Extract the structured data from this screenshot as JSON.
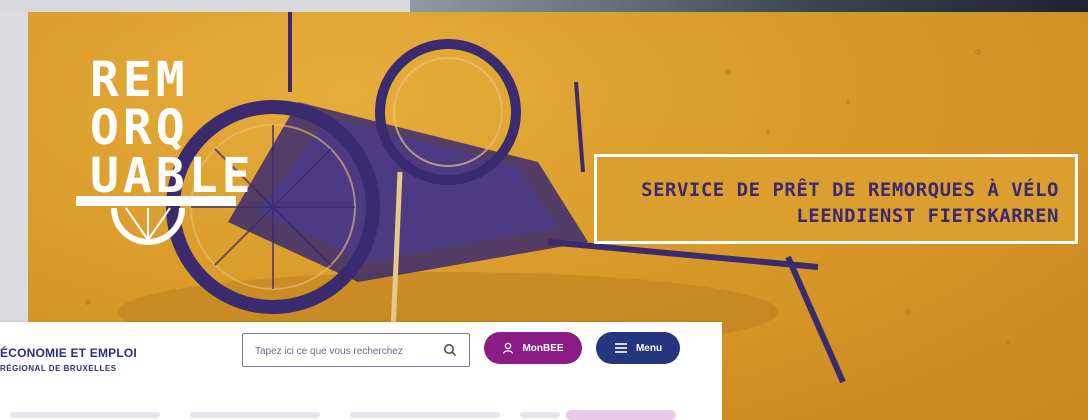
{
  "banner": {
    "logo_lines": [
      "REM",
      "ORQ",
      "UABLE"
    ],
    "tagline_fr": "SERVICE DE PRÊT DE REMORQUES À VÉLO",
    "tagline_nl": "LEENDIENST FIETSKARREN"
  },
  "header": {
    "brand_line1": "ÉCONOMIE ET EMPLOI",
    "brand_line2": "RÉGIONAL DE BRUXELLES",
    "search_placeholder": "Tapez ici ce que vous recherchez",
    "monbee_label": "MonBEE",
    "menu_label": "Menu"
  },
  "icons": {
    "search": "search-icon",
    "user": "user-icon",
    "menu": "hamburger-icon"
  },
  "colors": {
    "banner_orange": "#d99a2a",
    "banner_purple": "#3a2a6e",
    "monbee_purple": "#8b1c85",
    "menu_blue": "#26357f",
    "brand_navy": "#2b2f7d"
  }
}
